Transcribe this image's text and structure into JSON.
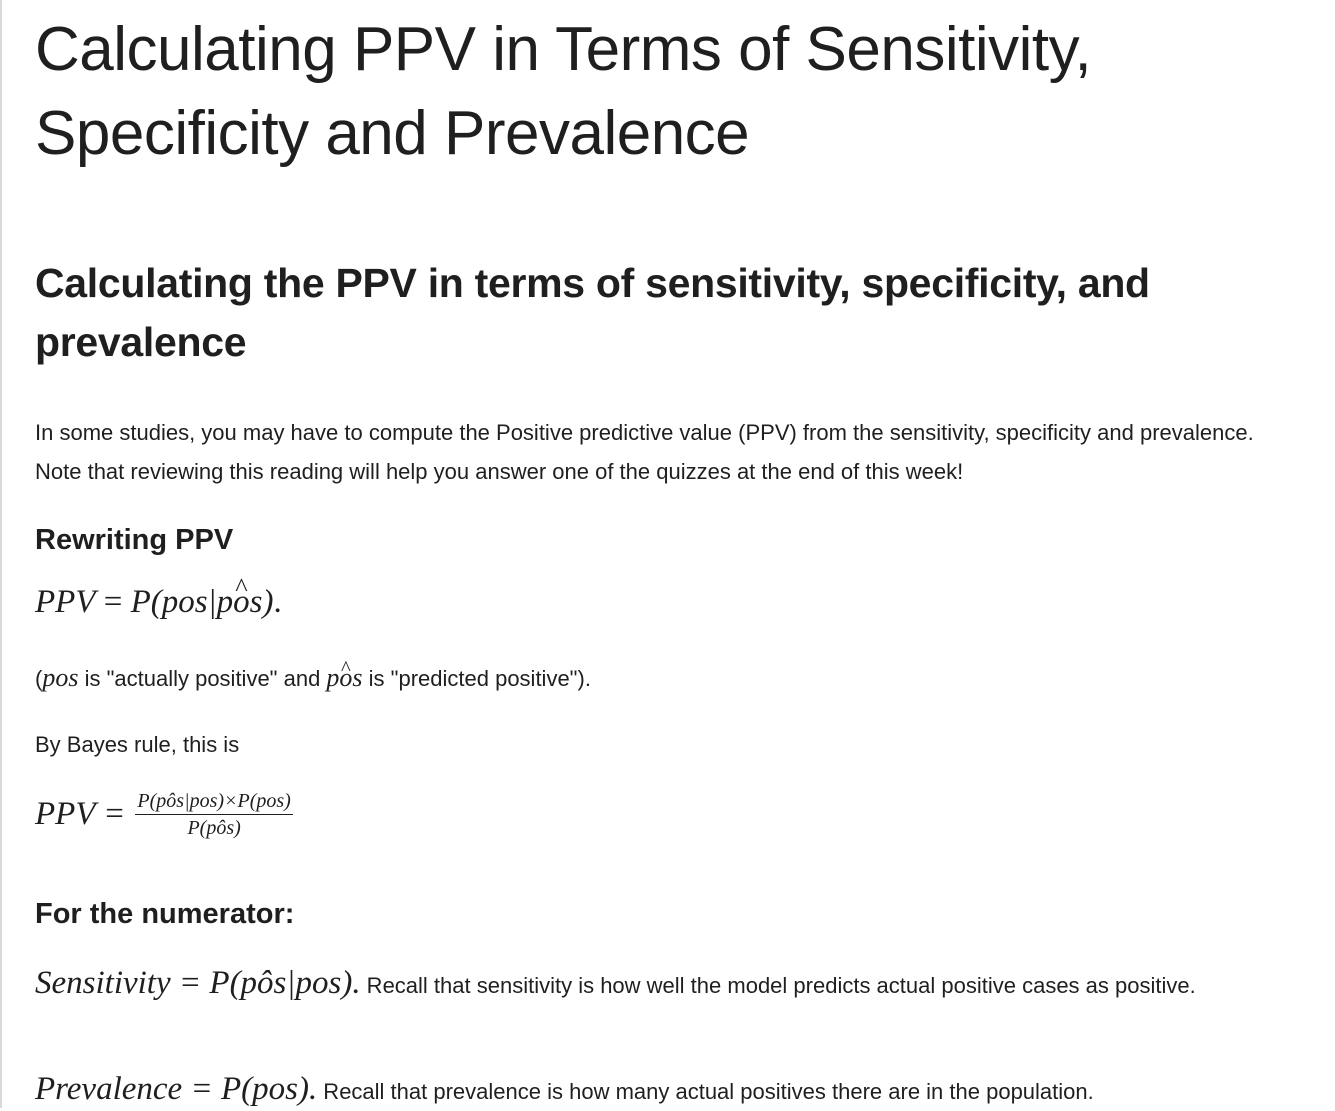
{
  "page": {
    "title": "Calculating PPV in Terms of Sensitivity, Specificity and Prevalence"
  },
  "section": {
    "title": "Calculating the PPV in terms of sensitivity, specificity, and prevalence",
    "intro": "In some studies, you may have to compute the Positive predictive value (PPV) from the sensitivity, specificity and prevalence.  Note that reviewing this reading will help you answer one of the quizzes at the end of this week!"
  },
  "rewriting": {
    "heading": "Rewriting PPV",
    "ppv_lhs": "PPV",
    "ppv_eq": " = ",
    "ppv_rhs_prefix": "P(pos|p",
    "ppv_rhs_hat": "o",
    "ppv_rhs_suffix": "s)",
    "period": ".",
    "note_open": "(",
    "note_pos": "pos",
    "note_mid": " is \"actually positive\" and ",
    "note_phat_prefix": "p",
    "note_phat_hat": "o",
    "note_phat_suffix": "s",
    "note_end": " is \"predicted positive\").",
    "bayes_intro": "By Bayes rule, this is",
    "bayes_lhs": "PPV = ",
    "bayes_num": "P(pôs|pos)×P(pos)",
    "bayes_den": "P(pôs)"
  },
  "numerator": {
    "heading": "For the numerator:",
    "sens_math_lhs": "Sensitivity",
    "sens_math_rhs": " = P(pôs|pos)",
    "sens_period": ".",
    "sens_text": " Recall that sensitivity is how well the model predicts actual positive cases as positive.",
    "prev_math_lhs": "Prevalence",
    "prev_math_rhs": " = P(pos)",
    "prev_period": ".",
    "prev_text": " Recall that prevalence is how many actual positives there are in the population."
  }
}
